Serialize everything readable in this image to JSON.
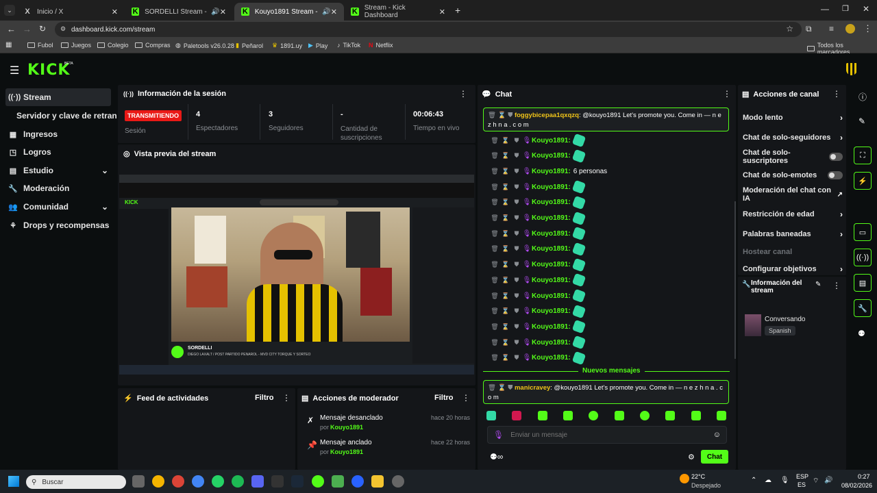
{
  "tabs": [
    {
      "title": "Inicio / X",
      "icon": "x-icon"
    },
    {
      "title": "SORDELLI Stream - Watch L",
      "icon": "kick-icon"
    },
    {
      "title": "Kouyo1891 Stream - Watch",
      "icon": "kick-icon"
    },
    {
      "title": "Stream - Kick Dashboard",
      "icon": "kick-icon"
    }
  ],
  "url": "dashboard.kick.com/stream",
  "bookmarks": [
    "Fubol",
    "Juegos",
    "Colegio",
    "Compras",
    "Paletools v26.0.28",
    "Peñarol",
    "1891.uy",
    "Play",
    "TikTok",
    "Netflix"
  ],
  "bookmarks_right": "Todos los marcadores",
  "logo": "KICK",
  "logo_badge": "BETA",
  "sidebar": [
    {
      "label": "Stream",
      "icon": "stream-icon"
    },
    {
      "label": "Servidor y clave de retransm",
      "icon": ""
    },
    {
      "label": "Ingresos",
      "icon": "revenue-icon"
    },
    {
      "label": "Logros",
      "icon": "trophy-icon"
    },
    {
      "label": "Estudio",
      "icon": "studio-icon"
    },
    {
      "label": "Moderación",
      "icon": "wrench-icon"
    },
    {
      "label": "Comunidad",
      "icon": "community-icon"
    },
    {
      "label": "Drops y recompensas",
      "icon": "drops-icon"
    }
  ],
  "session": {
    "title": "Información de la sesión",
    "status": "TRANSMITIENDO",
    "status_label": "Sesión",
    "stats": [
      {
        "value": "4",
        "label": "Espectadores"
      },
      {
        "value": "3",
        "label": "Seguidores"
      },
      {
        "value": "-",
        "label": "Cantidad de suscripciones"
      },
      {
        "value": "00:06:43",
        "label": "Tiempo en vivo"
      }
    ]
  },
  "preview": {
    "title": "Vista previa del stream",
    "streamer": "SORDELLI",
    "stream_title": "DIEGO LAXALT / POST PARTIDO PEÑAROL - MVD CITY TORQUE Y SORTEO"
  },
  "feed": {
    "title": "Feed de actividades",
    "filter": "Filtro"
  },
  "modactions": {
    "title": "Acciones de moderador",
    "filter": "Filtro",
    "items": [
      {
        "action": "Mensaje desanclado",
        "time": "hace 20 horas",
        "by": "por",
        "user": "Kouyo1891"
      },
      {
        "action": "Mensaje anclado",
        "time": "hace 22 horas",
        "by": "por",
        "user": "Kouyo1891"
      }
    ]
  },
  "chat": {
    "title": "Chat",
    "pinned": {
      "user": "foggybicepaa1qxqzq",
      "text": "@kouyo1891 Let's promote you. Come in — n e z h n a . c o m"
    },
    "rows": [
      {
        "user": "Kouyo1891:",
        "text": "",
        "emote": true
      },
      {
        "user": "Kouyo1891:",
        "text": "",
        "emote": true
      },
      {
        "user": "Kouyo1891:",
        "text": "6 personas",
        "emote": false
      },
      {
        "user": "Kouyo1891:",
        "text": "",
        "emote": true
      },
      {
        "user": "Kouyo1891:",
        "text": "",
        "emote": true
      },
      {
        "user": "Kouyo1891:",
        "text": "",
        "emote": true
      },
      {
        "user": "Kouyo1891:",
        "text": "",
        "emote": true
      },
      {
        "user": "Kouyo1891:",
        "text": "",
        "emote": true
      },
      {
        "user": "Kouyo1891:",
        "text": "",
        "emote": true
      },
      {
        "user": "Kouyo1891:",
        "text": "",
        "emote": true
      },
      {
        "user": "Kouyo1891:",
        "text": "",
        "emote": true
      },
      {
        "user": "Kouyo1891:",
        "text": "",
        "emote": true
      },
      {
        "user": "Kouyo1891:",
        "text": "",
        "emote": true
      },
      {
        "user": "Kouyo1891:",
        "text": "",
        "emote": true
      },
      {
        "user": "Kouyo1891:",
        "text": "",
        "emote": true
      }
    ],
    "new_messages": "Nuevos mensajes",
    "last": {
      "user": "manicravey",
      "text": "@kouyo1891 Let's promote you. Come in — n e z h n a . c o m"
    },
    "placeholder": "Enviar un mensaje",
    "send": "Chat"
  },
  "channel_actions": {
    "title": "Acciones de canal",
    "items": [
      {
        "label": "Modo lento",
        "kind": "chevron"
      },
      {
        "label": "Chat de solo-seguidores",
        "kind": "chevron"
      },
      {
        "label": "Chat de solo-suscriptores",
        "kind": "toggle"
      },
      {
        "label": "Chat de solo-emotes",
        "kind": "toggle"
      },
      {
        "label": "Moderación del chat con IA",
        "kind": "link"
      },
      {
        "label": "Restricción de edad",
        "kind": "chevron"
      },
      {
        "label": "Palabras baneadas",
        "kind": "chevron"
      },
      {
        "label": "Hostear canal",
        "kind": "disabled"
      },
      {
        "label": "Configurar objetivos",
        "kind": "chevron"
      }
    ]
  },
  "stream_info": {
    "title": "Información del stream",
    "category": "Conversando",
    "language": "Spanish"
  },
  "taskbar": {
    "search": "Buscar",
    "weather_temp": "22°C",
    "weather_text": "Despejado",
    "lang1": "ESP",
    "lang2": "ES",
    "time": "0:27",
    "date": "08/02/2026"
  }
}
